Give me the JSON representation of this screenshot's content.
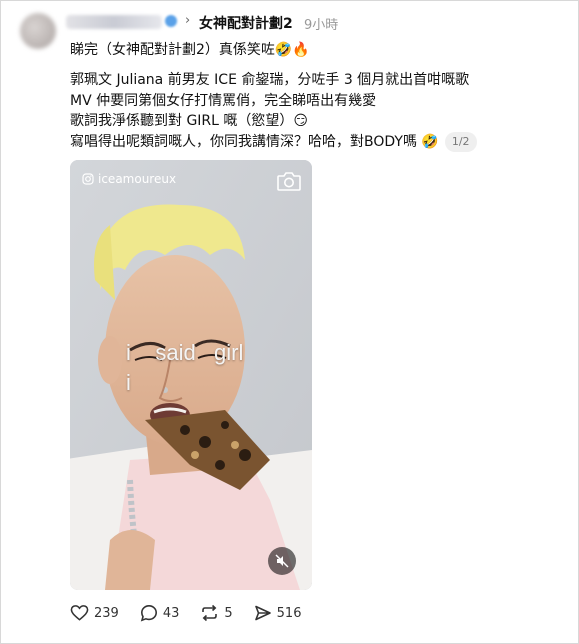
{
  "post": {
    "community": "女神配對計劃2",
    "time": "9小時",
    "headline": "睇完（女神配對計劃2）真係笑咗🤣🔥",
    "body_lines": [
      "郭珮文 Juliana 前男友 ICE 俞鋆瑞，分咗手 3 個月就出首咁嘅歌",
      "MV 仲要同第個女仔打情罵俏，完全睇唔出有幾愛",
      "歌詞我淨係聽到對 GIRL 嘅（慾望）😏",
      "寫唱得出呢類詞嘅人，你同我講情深？哈哈，對BODY嗎 🤣"
    ],
    "media_counter": "1/2"
  },
  "media": {
    "instagram_handle": "iceamoureux",
    "lyric_line1": "i    said   girl",
    "lyric_line2": "i"
  },
  "actions": {
    "likes": "239",
    "comments": "43",
    "reposts": "5",
    "shares": "516"
  },
  "icons": {
    "chevron": "chevron-right-icon",
    "verified": "verified-badge-icon",
    "instagram": "instagram-icon",
    "camera": "camera-icon",
    "mute": "muted-speaker-icon",
    "like": "heart-icon",
    "comment": "comment-bubble-icon",
    "repost": "repost-arrows-icon",
    "share": "send-arrow-icon"
  }
}
